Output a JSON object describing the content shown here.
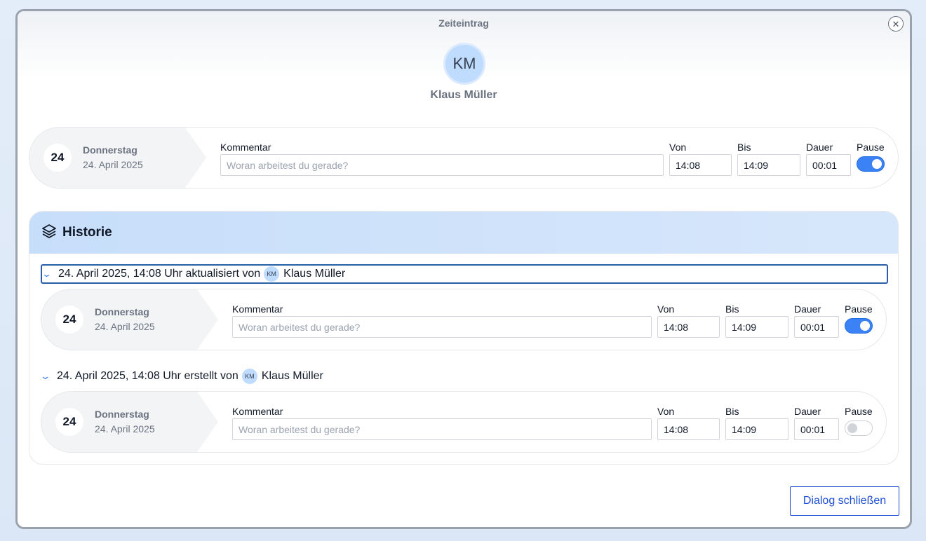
{
  "dialog": {
    "title": "Zeiteintrag",
    "close_icon": "close-icon",
    "user_initials": "KM",
    "user_name": "Klaus Müller",
    "close_button_label": "Dialog schließen"
  },
  "labels": {
    "comment": "Kommentar",
    "from": "Von",
    "to": "Bis",
    "duration": "Dauer",
    "pause": "Pause"
  },
  "current_entry": {
    "day": "24",
    "weekday": "Donnerstag",
    "date": "24. April 2025",
    "comment_placeholder": "Woran arbeitest du gerade?",
    "from": "14:08",
    "to": "14:09",
    "duration": "00:01",
    "pause": true
  },
  "history": {
    "title": "Historie",
    "icon": "layers-icon",
    "revisions": [
      {
        "header": "24. April 2025, 14:08 Uhr aktualisiert von",
        "author_initials": "KM",
        "author": "Klaus Müller",
        "entry": {
          "day": "24",
          "weekday": "Donnerstag",
          "date": "24. April 2025",
          "comment_placeholder": "Woran arbeitest du gerade?",
          "from": "14:08",
          "to": "14:09",
          "duration": "00:01",
          "pause": true
        }
      },
      {
        "header": "24. April 2025, 14:08 Uhr erstellt von",
        "author_initials": "KM",
        "author": "Klaus Müller",
        "entry": {
          "day": "24",
          "weekday": "Donnerstag",
          "date": "24. April 2025",
          "comment_placeholder": "Woran arbeitest du gerade?",
          "from": "14:08",
          "to": "14:09",
          "duration": "00:01",
          "pause": false
        }
      }
    ]
  },
  "colors": {
    "accent": "#3b82f6",
    "history_header": "#c7defa",
    "avatar": "#bfdbfe"
  }
}
